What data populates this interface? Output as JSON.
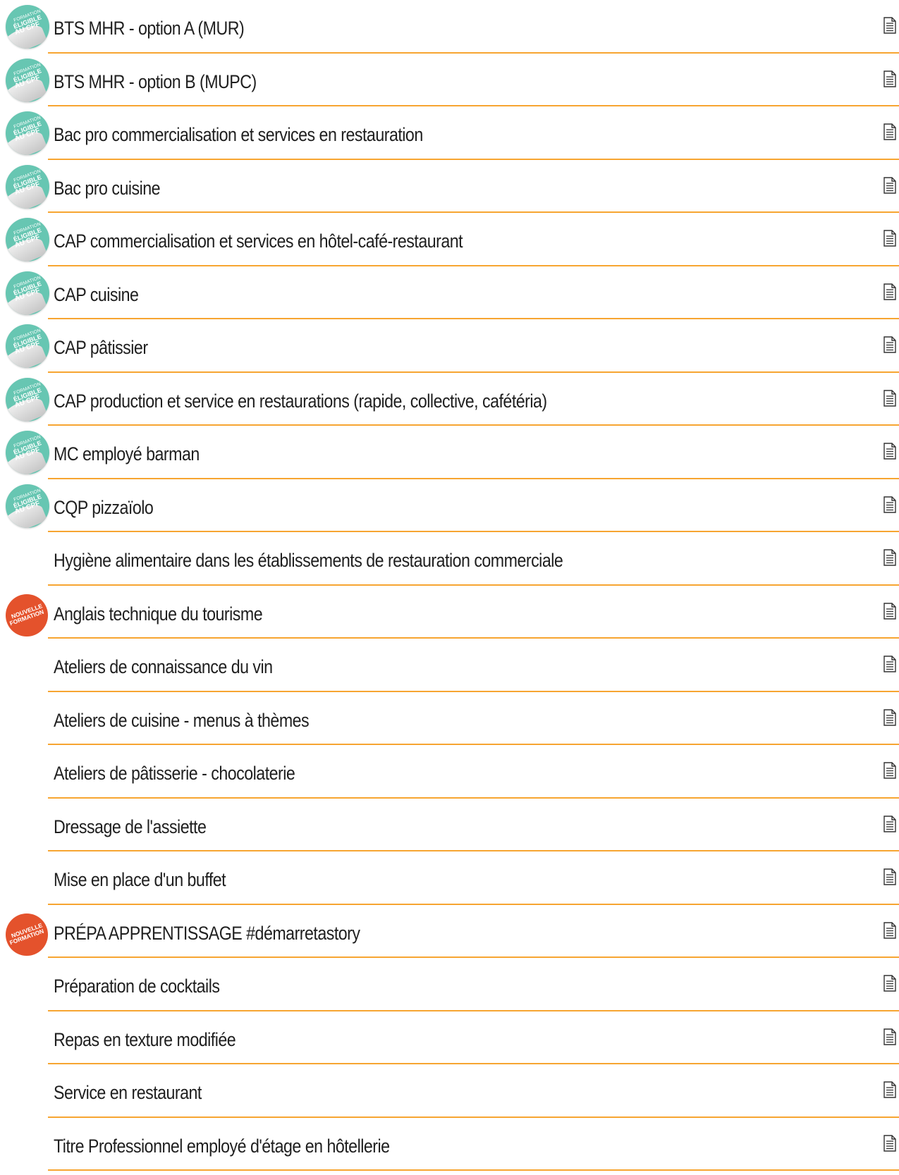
{
  "badges": {
    "cpf": {
      "line1": "FORMATION",
      "line2": "ÉLIGIBLE",
      "line3": "AU CPF",
      "color": "#67c6b2"
    },
    "new": {
      "line1": "NOUVELLE",
      "line2": "FORMATION",
      "color": "#e4522c"
    }
  },
  "separator_color": "#f7a531",
  "icons": {
    "row_action": "document-icon"
  },
  "formations": [
    {
      "title": "BTS MHR - option A (MUR)",
      "badge": "cpf"
    },
    {
      "title": "BTS MHR - option B (MUPC)",
      "badge": "cpf"
    },
    {
      "title": "Bac pro commercialisation et services en restauration",
      "badge": "cpf"
    },
    {
      "title": "Bac pro cuisine",
      "badge": "cpf"
    },
    {
      "title": "CAP commercialisation et services en hôtel-café-restaurant",
      "badge": "cpf"
    },
    {
      "title": "CAP cuisine",
      "badge": "cpf"
    },
    {
      "title": "CAP pâtissier",
      "badge": "cpf"
    },
    {
      "title": "CAP production et service en restaurations (rapide, collective, cafétéria)",
      "badge": "cpf"
    },
    {
      "title": "MC employé barman",
      "badge": "cpf"
    },
    {
      "title": "CQP pizzaïolo",
      "badge": "cpf"
    },
    {
      "title": "Hygiène alimentaire dans les établissements de restauration commerciale",
      "badge": ""
    },
    {
      "title": "Anglais technique du tourisme",
      "badge": "new"
    },
    {
      "title": "Ateliers de connaissance du vin",
      "badge": ""
    },
    {
      "title": "Ateliers de cuisine - menus à thèmes",
      "badge": ""
    },
    {
      "title": "Ateliers de pâtisserie - chocolaterie",
      "badge": ""
    },
    {
      "title": "Dressage de l'assiette",
      "badge": ""
    },
    {
      "title": "Mise en place d'un buffet",
      "badge": ""
    },
    {
      "title": "PRÉPA APPRENTISSAGE #démarretastory",
      "badge": "new"
    },
    {
      "title": "Préparation de cocktails",
      "badge": ""
    },
    {
      "title": "Repas en texture modifiée",
      "badge": ""
    },
    {
      "title": "Service en restaurant",
      "badge": ""
    },
    {
      "title": "Titre Professionnel employé d'étage en hôtellerie",
      "badge": ""
    }
  ]
}
